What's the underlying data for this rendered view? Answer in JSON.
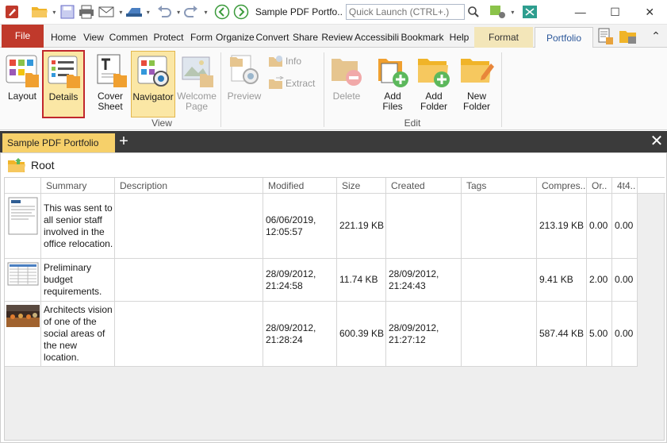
{
  "app": {
    "doc_title": "Sample PDF Portfo..",
    "quick_launch_placeholder": "Quick Launch (CTRL+.)"
  },
  "window_controls": {
    "minimize": "—",
    "maximize": "☐",
    "close": "✕"
  },
  "ribbon_tabs": [
    {
      "label": "File"
    },
    {
      "label": "Home"
    },
    {
      "label": "View"
    },
    {
      "label": "Commen"
    },
    {
      "label": "Protect"
    },
    {
      "label": "Form"
    },
    {
      "label": "Organize"
    },
    {
      "label": "Convert"
    },
    {
      "label": "Share"
    },
    {
      "label": "Review"
    },
    {
      "label": "Accessibili"
    },
    {
      "label": "Bookmark"
    },
    {
      "label": "Help"
    },
    {
      "label": "Format"
    },
    {
      "label": "Portfolio"
    }
  ],
  "ribbon": {
    "view_group": {
      "label": "View",
      "layout": "Layout",
      "details": "Details",
      "cover_sheet_1": "Cover",
      "cover_sheet_2": "Sheet",
      "navigator": "Navigator",
      "welcome_1": "Welcome",
      "welcome_2": "Page"
    },
    "preview": "Preview",
    "info": "Info",
    "extract": "Extract",
    "edit_group": {
      "label": "Edit",
      "delete": "Delete",
      "add_files_1": "Add",
      "add_files_2": "Files",
      "add_folder_1": "Add",
      "add_folder_2": "Folder",
      "new_folder_1": "New",
      "new_folder_2": "Folder"
    }
  },
  "doc_tab": {
    "label": "Sample PDF Portfolio",
    "new_symbol": "+",
    "close_symbol": "✕"
  },
  "root_label": "Root",
  "columns": [
    "Summary",
    "Description",
    "Modified",
    "Size",
    "Created",
    "Tags",
    "Compres..",
    "Or..",
    "4t4.."
  ],
  "rows": [
    {
      "summary": "This was sent to all senior staff involved in the office relocation.",
      "description": "",
      "modified": "06/06/2019, 12:05:57",
      "size": "221.19 KB",
      "created": "",
      "tags": "",
      "compressed": "213.19 KB",
      "order": "0.00",
      "col4t4": "0.00"
    },
    {
      "summary": "Preliminary budget requirements.",
      "description": "",
      "modified": "28/09/2012, 21:24:58",
      "size": "11.74 KB",
      "created": "28/09/2012, 21:24:43",
      "tags": "",
      "compressed": "9.41 KB",
      "order": "2.00",
      "col4t4": "0.00"
    },
    {
      "summary": "Architects vision of one of the social areas of the new location.",
      "description": "",
      "modified": "28/09/2012, 21:28:24",
      "size": "600.39 KB",
      "created": "28/09/2012, 21:27:12",
      "tags": "",
      "compressed": "587.44 KB",
      "order": "5.00",
      "col4t4": "0.00"
    }
  ]
}
